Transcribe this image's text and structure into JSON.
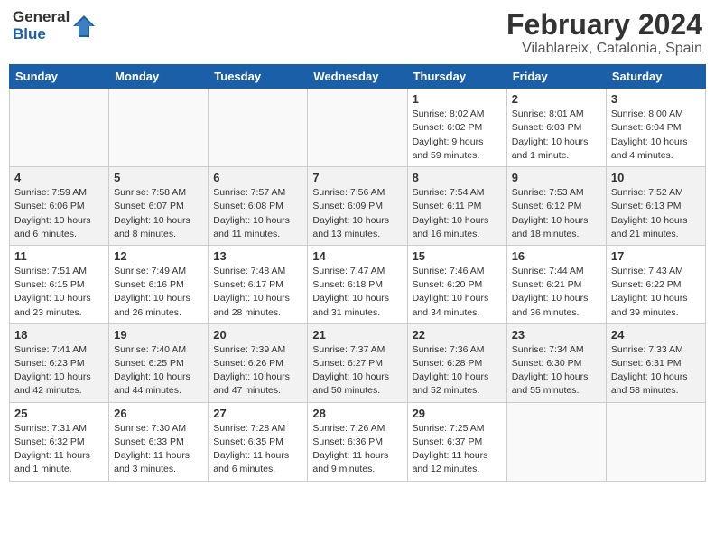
{
  "header": {
    "logo_general": "General",
    "logo_blue": "Blue",
    "title": "February 2024",
    "subtitle": "Vilablareix, Catalonia, Spain"
  },
  "weekdays": [
    "Sunday",
    "Monday",
    "Tuesday",
    "Wednesday",
    "Thursday",
    "Friday",
    "Saturday"
  ],
  "weeks": [
    [
      {
        "day": "",
        "info": ""
      },
      {
        "day": "",
        "info": ""
      },
      {
        "day": "",
        "info": ""
      },
      {
        "day": "",
        "info": ""
      },
      {
        "day": "1",
        "info": "Sunrise: 8:02 AM\nSunset: 6:02 PM\nDaylight: 9 hours\nand 59 minutes."
      },
      {
        "day": "2",
        "info": "Sunrise: 8:01 AM\nSunset: 6:03 PM\nDaylight: 10 hours\nand 1 minute."
      },
      {
        "day": "3",
        "info": "Sunrise: 8:00 AM\nSunset: 6:04 PM\nDaylight: 10 hours\nand 4 minutes."
      }
    ],
    [
      {
        "day": "4",
        "info": "Sunrise: 7:59 AM\nSunset: 6:06 PM\nDaylight: 10 hours\nand 6 minutes."
      },
      {
        "day": "5",
        "info": "Sunrise: 7:58 AM\nSunset: 6:07 PM\nDaylight: 10 hours\nand 8 minutes."
      },
      {
        "day": "6",
        "info": "Sunrise: 7:57 AM\nSunset: 6:08 PM\nDaylight: 10 hours\nand 11 minutes."
      },
      {
        "day": "7",
        "info": "Sunrise: 7:56 AM\nSunset: 6:09 PM\nDaylight: 10 hours\nand 13 minutes."
      },
      {
        "day": "8",
        "info": "Sunrise: 7:54 AM\nSunset: 6:11 PM\nDaylight: 10 hours\nand 16 minutes."
      },
      {
        "day": "9",
        "info": "Sunrise: 7:53 AM\nSunset: 6:12 PM\nDaylight: 10 hours\nand 18 minutes."
      },
      {
        "day": "10",
        "info": "Sunrise: 7:52 AM\nSunset: 6:13 PM\nDaylight: 10 hours\nand 21 minutes."
      }
    ],
    [
      {
        "day": "11",
        "info": "Sunrise: 7:51 AM\nSunset: 6:15 PM\nDaylight: 10 hours\nand 23 minutes."
      },
      {
        "day": "12",
        "info": "Sunrise: 7:49 AM\nSunset: 6:16 PM\nDaylight: 10 hours\nand 26 minutes."
      },
      {
        "day": "13",
        "info": "Sunrise: 7:48 AM\nSunset: 6:17 PM\nDaylight: 10 hours\nand 28 minutes."
      },
      {
        "day": "14",
        "info": "Sunrise: 7:47 AM\nSunset: 6:18 PM\nDaylight: 10 hours\nand 31 minutes."
      },
      {
        "day": "15",
        "info": "Sunrise: 7:46 AM\nSunset: 6:20 PM\nDaylight: 10 hours\nand 34 minutes."
      },
      {
        "day": "16",
        "info": "Sunrise: 7:44 AM\nSunset: 6:21 PM\nDaylight: 10 hours\nand 36 minutes."
      },
      {
        "day": "17",
        "info": "Sunrise: 7:43 AM\nSunset: 6:22 PM\nDaylight: 10 hours\nand 39 minutes."
      }
    ],
    [
      {
        "day": "18",
        "info": "Sunrise: 7:41 AM\nSunset: 6:23 PM\nDaylight: 10 hours\nand 42 minutes."
      },
      {
        "day": "19",
        "info": "Sunrise: 7:40 AM\nSunset: 6:25 PM\nDaylight: 10 hours\nand 44 minutes."
      },
      {
        "day": "20",
        "info": "Sunrise: 7:39 AM\nSunset: 6:26 PM\nDaylight: 10 hours\nand 47 minutes."
      },
      {
        "day": "21",
        "info": "Sunrise: 7:37 AM\nSunset: 6:27 PM\nDaylight: 10 hours\nand 50 minutes."
      },
      {
        "day": "22",
        "info": "Sunrise: 7:36 AM\nSunset: 6:28 PM\nDaylight: 10 hours\nand 52 minutes."
      },
      {
        "day": "23",
        "info": "Sunrise: 7:34 AM\nSunset: 6:30 PM\nDaylight: 10 hours\nand 55 minutes."
      },
      {
        "day": "24",
        "info": "Sunrise: 7:33 AM\nSunset: 6:31 PM\nDaylight: 10 hours\nand 58 minutes."
      }
    ],
    [
      {
        "day": "25",
        "info": "Sunrise: 7:31 AM\nSunset: 6:32 PM\nDaylight: 11 hours\nand 1 minute."
      },
      {
        "day": "26",
        "info": "Sunrise: 7:30 AM\nSunset: 6:33 PM\nDaylight: 11 hours\nand 3 minutes."
      },
      {
        "day": "27",
        "info": "Sunrise: 7:28 AM\nSunset: 6:35 PM\nDaylight: 11 hours\nand 6 minutes."
      },
      {
        "day": "28",
        "info": "Sunrise: 7:26 AM\nSunset: 6:36 PM\nDaylight: 11 hours\nand 9 minutes."
      },
      {
        "day": "29",
        "info": "Sunrise: 7:25 AM\nSunset: 6:37 PM\nDaylight: 11 hours\nand 12 minutes."
      },
      {
        "day": "",
        "info": ""
      },
      {
        "day": "",
        "info": ""
      }
    ]
  ]
}
